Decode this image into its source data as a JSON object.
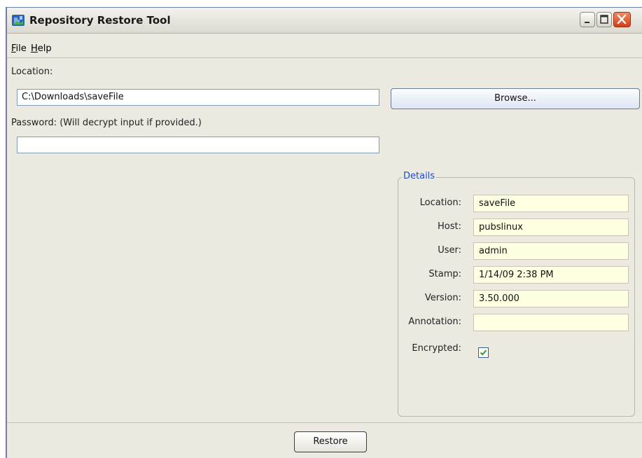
{
  "window": {
    "title": "Repository Restore Tool",
    "icon": "app-puzzle-icon",
    "controls": [
      "minimize-icon",
      "maximize-icon",
      "close-icon"
    ]
  },
  "menubar": {
    "items": [
      {
        "label": "File",
        "mnemonic": "F"
      },
      {
        "label": "Help",
        "mnemonic": "H"
      }
    ]
  },
  "form": {
    "location_label": "Location:",
    "location_value": "C:\\Downloads\\saveFile",
    "browse_label": "Browse...",
    "password_label": "Password: (Will decrypt input if provided.)",
    "password_value": ""
  },
  "details": {
    "legend": "Details",
    "fields": [
      {
        "label": "Location:",
        "value": "saveFile"
      },
      {
        "label": "Host:",
        "value": "pubslinux"
      },
      {
        "label": "User:",
        "value": "admin"
      },
      {
        "label": "Stamp:",
        "value": "1/14/09 2:38 PM"
      },
      {
        "label": "Version:",
        "value": "3.50.000"
      },
      {
        "label": "Annotation:",
        "value": ""
      }
    ],
    "encrypted_label": "Encrypted:",
    "encrypted": true
  },
  "footer": {
    "restore_label": "Restore"
  },
  "colors": {
    "accent": "#1b4fc9",
    "readonly_field": "#ffffe1",
    "window_bg": "#ece9e0",
    "close_button": "#d0401c",
    "checkmark": "#2f9e2f"
  }
}
